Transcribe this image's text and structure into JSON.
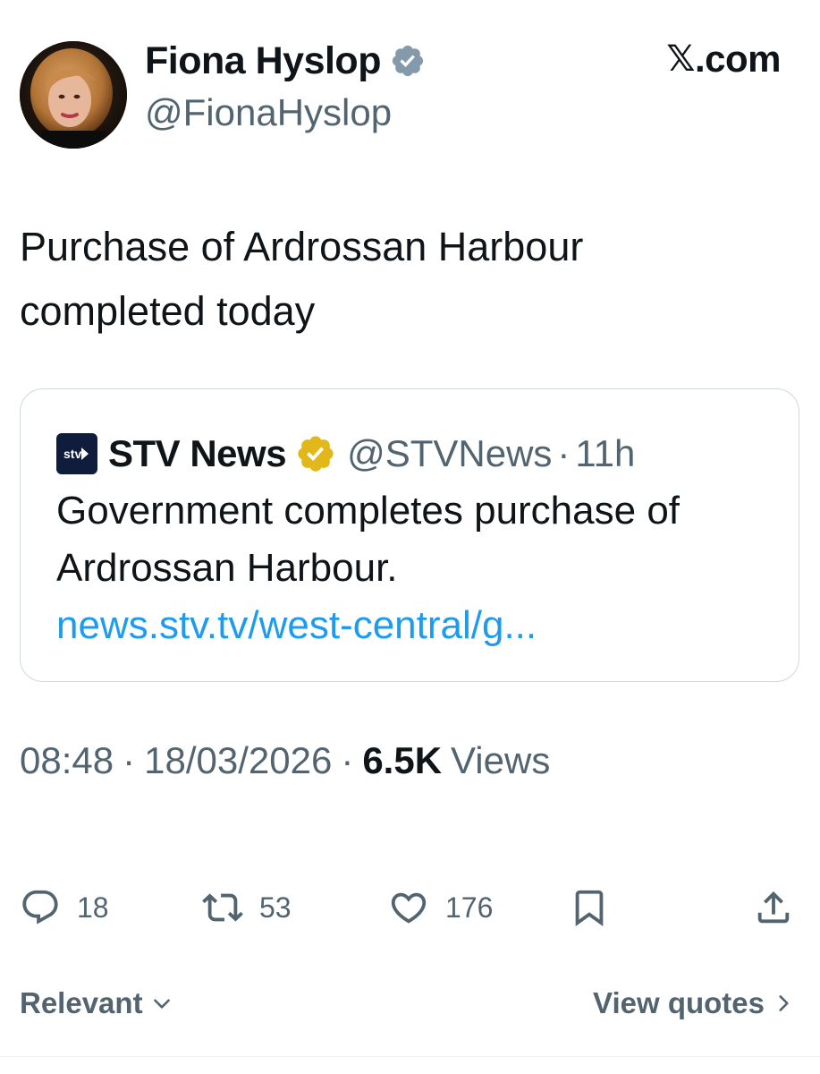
{
  "author": {
    "display_name": "Fiona Hyslop",
    "handle": "@FionaHyslop",
    "verified": "grey-verified-badge"
  },
  "source": {
    "site_prefix": "𝕏",
    "site_suffix": ".com"
  },
  "tweet": {
    "text_line1": "Purchase of Ardrossan Harbour",
    "text_line2": "completed today"
  },
  "quote": {
    "account_name": "STV News",
    "handle": "@STVNews",
    "separator": "·",
    "time_ago": "11h",
    "text_line1": "Government completes purchase of",
    "text_line2": "Ardrossan Harbour.",
    "link": "news.stv.tv/west-central/g...",
    "verified": "gold-verified-badge"
  },
  "meta": {
    "time": "08:48",
    "sep1": "·",
    "date": "18/03/2026",
    "sep2": "·",
    "views_count": "6.5K",
    "views_label": "Views"
  },
  "actions": {
    "replies": "18",
    "reposts": "53",
    "likes": "176"
  },
  "footer": {
    "sort_label": "Relevant",
    "quotes_label": "View quotes"
  },
  "colors": {
    "text": "#0f1419",
    "secondary": "#536471",
    "link": "#1d9bf0",
    "border": "#cfd9de",
    "gold_badge": "#e2b719",
    "grey_badge": "#829aab",
    "stv_logo_bg": "#101c3b"
  },
  "icons": {
    "reply": "speech-bubble-icon",
    "repost": "repost-arrows-icon",
    "like": "heart-icon",
    "bookmark": "bookmark-icon",
    "share": "share-upload-icon",
    "sort": "chevron-down-icon",
    "quotes": "chevron-right-icon"
  }
}
